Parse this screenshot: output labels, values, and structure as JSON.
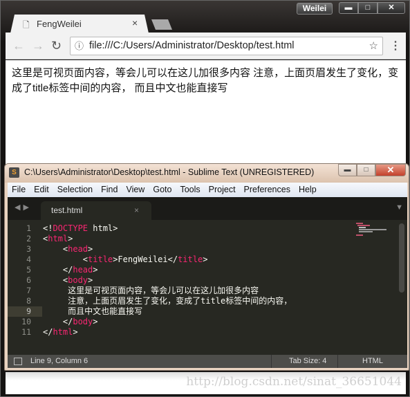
{
  "chrome": {
    "profile_name": "Weilei",
    "tab_title": "FengWeilei",
    "url": "file:///C:/Users/Administrator/Desktop/test.html",
    "page_text": "这里是可视页面内容，等会儿可以在这儿加很多内容 注意，上面页眉发生了变化，变成了title标签中间的内容， 而且中文也能直接写"
  },
  "sublime": {
    "title": "C:\\Users\\Administrator\\Desktop\\test.html - Sublime Text (UNREGISTERED)",
    "menu": [
      "File",
      "Edit",
      "Selection",
      "Find",
      "View",
      "Goto",
      "Tools",
      "Project",
      "Preferences",
      "Help"
    ],
    "tab": "test.html",
    "line_numbers": [
      "1",
      "2",
      "3",
      "4",
      "5",
      "6",
      "7",
      "8",
      "9",
      "10",
      "11"
    ],
    "current_line": 9,
    "code": [
      [
        {
          "t": "<!"
        },
        {
          "t": "DOCTYPE",
          "tag": true
        },
        {
          "t": " html>"
        }
      ],
      [
        {
          "t": "<"
        },
        {
          "t": "html",
          "tag": true
        },
        {
          "t": ">"
        }
      ],
      [
        {
          "t": "    <"
        },
        {
          "t": "head",
          "tag": true
        },
        {
          "t": ">"
        }
      ],
      [
        {
          "t": "        <"
        },
        {
          "t": "title",
          "tag": true
        },
        {
          "t": ">FengWeilei</"
        },
        {
          "t": "title",
          "tag": true
        },
        {
          "t": ">"
        }
      ],
      [
        {
          "t": "    </"
        },
        {
          "t": "head",
          "tag": true
        },
        {
          "t": ">"
        }
      ],
      [
        {
          "t": "    <"
        },
        {
          "t": "body",
          "tag": true
        },
        {
          "t": ">"
        }
      ],
      [
        {
          "t": "     这里是可视页面内容，等会儿可以在这儿加很多内容"
        }
      ],
      [
        {
          "t": "     注意，上面页眉发生了变化，变成了title标签中间的内容，"
        }
      ],
      [
        {
          "t": "     而且中文也能直接写"
        }
      ],
      [
        {
          "t": "    </"
        },
        {
          "t": "body",
          "tag": true
        },
        {
          "t": ">"
        }
      ],
      [
        {
          "t": "</"
        },
        {
          "t": "html",
          "tag": true
        },
        {
          "t": ">"
        }
      ]
    ],
    "status": {
      "position": "Line 9, Column 6",
      "tab_size": "Tab Size: 4",
      "syntax": "HTML"
    },
    "colors": {
      "tag": "#f92672",
      "text": "#f8f8f2",
      "background": "#272822"
    }
  },
  "watermark": "http://blog.csdn.net/sinat_36651044"
}
